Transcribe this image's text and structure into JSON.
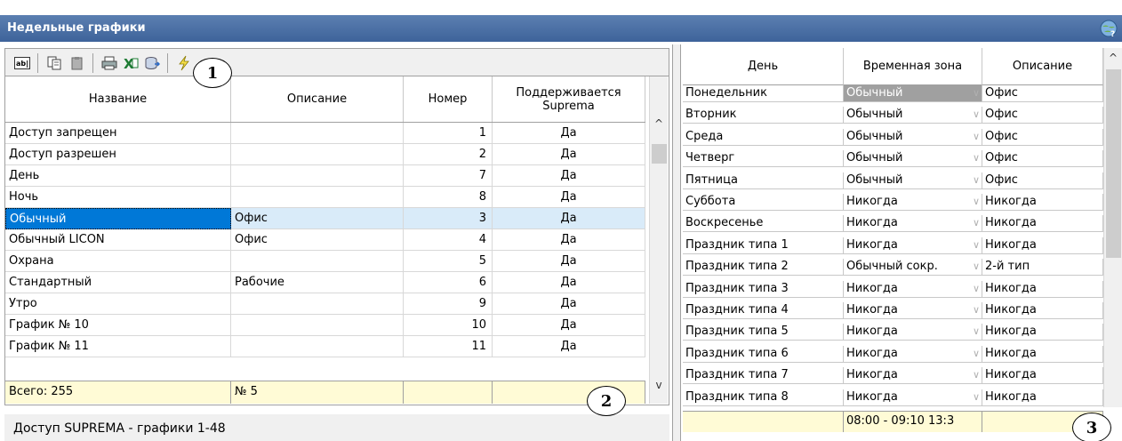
{
  "window": {
    "title": "Недельные графики",
    "corner_icon": "globe-help-icon"
  },
  "toolbar": {
    "buttons": [
      {
        "icon": "rename-field-icon",
        "label": "ab|"
      },
      {
        "icon": "copy-icon",
        "label": ""
      },
      {
        "icon": "paste-icon",
        "label": ""
      },
      {
        "icon": "print-icon",
        "label": ""
      },
      {
        "icon": "excel-export-icon",
        "label": ""
      },
      {
        "icon": "database-export-icon",
        "label": ""
      },
      {
        "icon": "lightning-icon",
        "label": ""
      }
    ]
  },
  "callouts": [
    "1",
    "2",
    "3"
  ],
  "schedules": {
    "columns": [
      "Название",
      "Описание",
      "Номер",
      "Поддерживается Suprema"
    ],
    "rows": [
      {
        "name": "Доступ запрещен",
        "desc": "",
        "num": "1",
        "suprema": "Да"
      },
      {
        "name": "Доступ разрешен",
        "desc": "",
        "num": "2",
        "suprema": "Да"
      },
      {
        "name": "День",
        "desc": "",
        "num": "7",
        "suprema": "Да"
      },
      {
        "name": "Ночь",
        "desc": "",
        "num": "8",
        "suprema": "Да"
      },
      {
        "name": "Обычный",
        "desc": "Офис",
        "num": "3",
        "suprema": "Да",
        "selected": true
      },
      {
        "name": "Обычный LICON",
        "desc": "Офис",
        "num": "4",
        "suprema": "Да"
      },
      {
        "name": "Охрана",
        "desc": "",
        "num": "5",
        "suprema": "Да"
      },
      {
        "name": "Стандартный",
        "desc": "Рабочие",
        "num": "6",
        "suprema": "Да"
      },
      {
        "name": "Утро",
        "desc": "",
        "num": "9",
        "suprema": "Да"
      },
      {
        "name": "График  №  10",
        "desc": "",
        "num": "10",
        "suprema": "Да"
      },
      {
        "name": "График  №  11",
        "desc": "",
        "num": "11",
        "suprema": "Да"
      }
    ],
    "footer": {
      "total": "Всего: 255",
      "current": "№ 5",
      "col3": "",
      "col4": ""
    }
  },
  "status": {
    "text": "Доступ SUPREMA - графики 1-48"
  },
  "days": {
    "columns": [
      "День",
      "Временная зона",
      "Описание"
    ],
    "rows": [
      {
        "day": "Понедельник",
        "zone": "Обычный",
        "desc": "Офис",
        "selected": true
      },
      {
        "day": "Вторник",
        "zone": "Обычный",
        "desc": "Офис"
      },
      {
        "day": "Среда",
        "zone": "Обычный",
        "desc": "Офис"
      },
      {
        "day": "Четверг",
        "zone": "Обычный",
        "desc": "Офис"
      },
      {
        "day": "Пятница",
        "zone": "Обычный",
        "desc": "Офис"
      },
      {
        "day": "Суббота",
        "zone": "Никогда",
        "desc": "Никогда"
      },
      {
        "day": "Воскресенье",
        "zone": "Никогда",
        "desc": "Никогда"
      },
      {
        "day": "Праздник типа 1",
        "zone": "Никогда",
        "desc": "Никогда"
      },
      {
        "day": "Праздник типа 2",
        "zone": "Обычный сокр.",
        "desc": "2-й тип"
      },
      {
        "day": "Праздник типа 3",
        "zone": "Никогда",
        "desc": "Никогда"
      },
      {
        "day": "Праздник типа 4",
        "zone": "Никогда",
        "desc": "Никогда"
      },
      {
        "day": "Праздник типа 5",
        "zone": "Никогда",
        "desc": "Никогда"
      },
      {
        "day": "Праздник типа 6",
        "zone": "Никогда",
        "desc": "Никогда"
      },
      {
        "day": "Праздник типа 7",
        "zone": "Никогда",
        "desc": "Никогда"
      },
      {
        "day": "Праздник типа 8",
        "zone": "Никогда",
        "desc": "Никогда"
      }
    ],
    "footer": {
      "col1": "",
      "zone": "08:00 - 09:10  13:3",
      "col3": ""
    }
  },
  "colors": {
    "accent": "#0078d7",
    "title_bar": "#4a6fa5",
    "footer_bg": "#fffbd6",
    "selected_row": "#d9ebf9"
  }
}
